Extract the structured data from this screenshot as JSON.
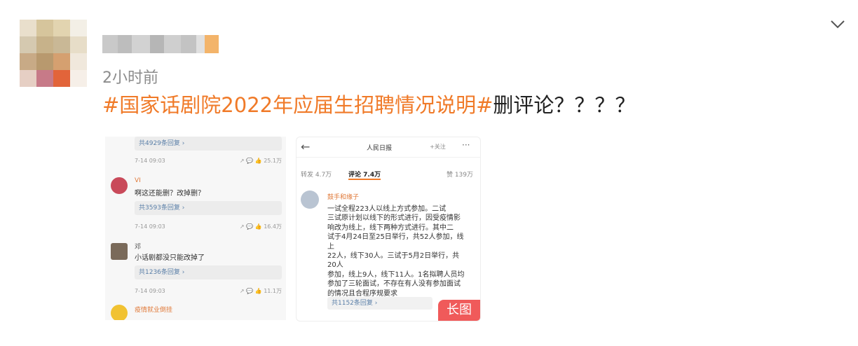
{
  "post": {
    "timestamp": "2小时前",
    "hashtag": "#国家话剧院2022年应届生招聘情况说明#",
    "text": "删评论？？？？"
  },
  "left_image": {
    "comments": [
      {
        "reply_label": "共4929条回复 ›",
        "date": "7-14 09:03",
        "likes": "25.1万"
      },
      {
        "name": "VI",
        "text": "啊这还能删？改掉删？",
        "reply_label": "共3593条回复 ›",
        "date": "7-14 09:03",
        "likes": "16.4万"
      },
      {
        "name": "邓",
        "text": "小话剧都没只能改掉了",
        "reply_label": "共1236条回复 ›",
        "date": "7-14 09:03",
        "likes": "11.1万"
      },
      {
        "name": "疫情就业倒挂",
        "text": ""
      }
    ]
  },
  "right_image": {
    "title": "人民日报",
    "follow": "+关注",
    "tabs": {
      "repost": "转发 4.7万",
      "comments": "评论 7.4万",
      "likes": "赞 139万"
    },
    "commenter": "鼓手和缘子",
    "body_lines": [
      "一试全程223人以线上方式参加。二试",
      "三试原计划以线下的形式进行，因受疫情影",
      "响改为线上，线下两种方式进行。其中二",
      "试于4月24日至25日举行，共52人参加，线上",
      "22人，线下30人。三试于5月2日举行，共20人",
      "参加，线上9人，线下11人。1名拟聘人员均",
      "参加了三轮面试，不存在有人没有参加面试",
      "的情况且合程序规要求"
    ],
    "reply_label": "共1152条回复 ›",
    "badge": "长图"
  },
  "colors": {
    "hashtag": "#f07a28",
    "badge": "#f05a5a"
  }
}
